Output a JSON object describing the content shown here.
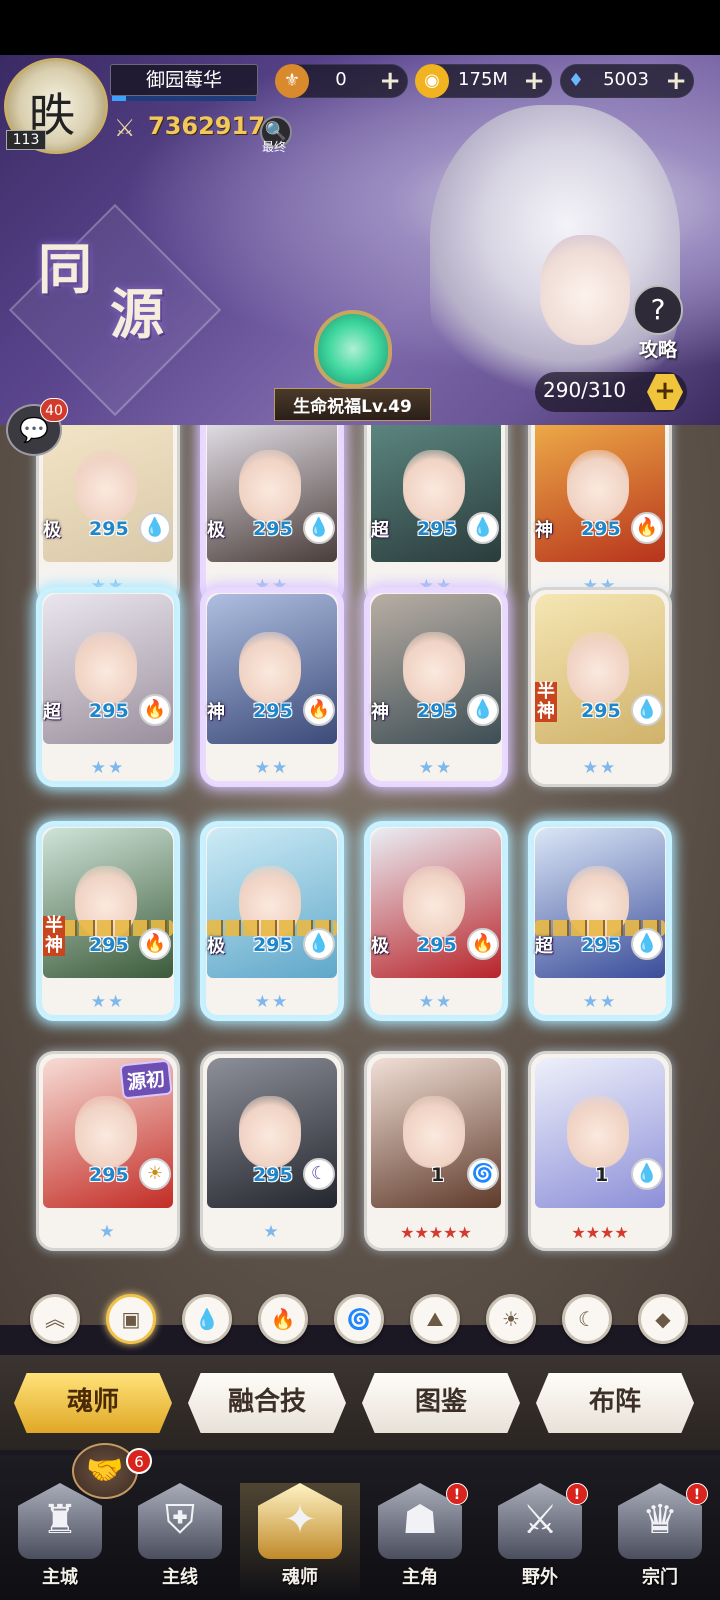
{
  "player": {
    "level": "113",
    "name": "御园莓华",
    "power": "7362917",
    "rank_label": "最终",
    "exp_progress": 0.1
  },
  "resources": [
    {
      "icon": "medal-icon",
      "value": "0"
    },
    {
      "icon": "gold-coin-icon",
      "value": "175M"
    },
    {
      "icon": "diamond-icon",
      "value": "5003"
    }
  ],
  "banner": {
    "title_char1": "同",
    "title_char2": "源",
    "strategy_label": "攻略",
    "blessing_label": "生命祝福Lv.49",
    "capacity": "290/310"
  },
  "chat": {
    "badge": "40"
  },
  "cards": [
    {
      "tier": "极",
      "level": "295",
      "element": "water",
      "stars": "★★",
      "art": [
        "#f4e6c8",
        "#d9c9a9"
      ],
      "glow": ""
    },
    {
      "tier": "极",
      "level": "295",
      "element": "water",
      "stars": "★★",
      "art": [
        "#e9e6ee",
        "#4a3d3a"
      ],
      "glow": "glowp"
    },
    {
      "tier": "超",
      "level": "295",
      "element": "water",
      "stars": "★★",
      "art": [
        "#5f8a84",
        "#2a3c3c"
      ],
      "glow": ""
    },
    {
      "tier": "神",
      "level": "295",
      "element": "fire",
      "stars": "★★",
      "art": [
        "#f0b14a",
        "#b7331c"
      ],
      "glow": ""
    },
    {
      "tier": "超",
      "level": "295",
      "element": "fire",
      "stars": "★★",
      "art": [
        "#eae6ee",
        "#9a8f9d"
      ],
      "glow": "glow"
    },
    {
      "tier": "神",
      "level": "295",
      "element": "fire",
      "stars": "★★",
      "art": [
        "#aebfe0",
        "#3b4a78"
      ],
      "glow": "glowp"
    },
    {
      "tier": "神",
      "level": "295",
      "element": "water",
      "stars": "★★",
      "art": [
        "#b9aea4",
        "#3d4e55"
      ],
      "glow": "glowp"
    },
    {
      "tier": "半神",
      "level": "295",
      "element": "water",
      "stars": "★★",
      "art": [
        "#f5e6b4",
        "#d0b26a"
      ],
      "glow": ""
    },
    {
      "tier": "半神",
      "level": "295",
      "element": "fire",
      "stars": "★★",
      "art": [
        "#cfe4d8",
        "#3b5a3a"
      ],
      "glow": "glow",
      "sealed": true
    },
    {
      "tier": "极",
      "level": "295",
      "element": "water",
      "stars": "★★",
      "art": [
        "#cdebf6",
        "#5fa7c9"
      ],
      "glow": "glow",
      "sealed": true
    },
    {
      "tier": "极",
      "level": "295",
      "element": "fire",
      "stars": "★★",
      "art": [
        "#e9eef4",
        "#b8232a"
      ],
      "glow": "glow"
    },
    {
      "tier": "超",
      "level": "295",
      "element": "water",
      "stars": "★★",
      "art": [
        "#dbe6f6",
        "#3a4d9a"
      ],
      "glow": "glow",
      "sealed": true
    },
    {
      "tier": "",
      "level": "295",
      "element": "light",
      "stars": "★",
      "art": [
        "#f6ddd6",
        "#c32c26"
      ],
      "glow": "",
      "badge": "源初"
    },
    {
      "tier": "",
      "level": "295",
      "element": "dark",
      "stars": "★",
      "art": [
        "#8d8f99",
        "#24262e"
      ],
      "glow": ""
    },
    {
      "tier": "",
      "level": "1",
      "element": "wind",
      "stars": "★★★★★",
      "art": [
        "#f1dfd6",
        "#5e3a2a"
      ],
      "glow": "",
      "red": true
    },
    {
      "tier": "",
      "level": "1",
      "element": "water",
      "stars": "★★★★",
      "art": [
        "#eef0fa",
        "#8c8fd8"
      ],
      "glow": "",
      "red": true
    }
  ],
  "elements": {
    "water": {
      "glyph": "💧",
      "color": "#1c8fd8"
    },
    "fire": {
      "glyph": "🔥",
      "color": "#c8322a"
    },
    "light": {
      "glyph": "☀",
      "color": "#c98d12"
    },
    "dark": {
      "glyph": "☾",
      "color": "#5e4fa8"
    },
    "wind": {
      "glyph": "🌀",
      "color": "#2f9a55"
    }
  },
  "filters": [
    {
      "name": "sort-filter-icon",
      "glyph": "︽"
    },
    {
      "name": "all-filter-icon",
      "glyph": "▣",
      "active": true
    },
    {
      "name": "water-filter-icon",
      "glyph": "💧"
    },
    {
      "name": "fire-filter-icon",
      "glyph": "🔥"
    },
    {
      "name": "wind-filter-icon",
      "glyph": "🌀"
    },
    {
      "name": "earth-filter-icon",
      "glyph": "⛰"
    },
    {
      "name": "light-filter-icon",
      "glyph": "☀"
    },
    {
      "name": "dark-filter-icon",
      "glyph": "☾"
    },
    {
      "name": "special-filter-icon",
      "glyph": "◆"
    }
  ],
  "tabs": [
    "魂师",
    "融合技",
    "图鉴",
    "布阵"
  ],
  "nav": [
    {
      "label": "主城",
      "glyph": "♜",
      "alert": false
    },
    {
      "label": "主线",
      "glyph": "⛨",
      "alert": false
    },
    {
      "label": "魂师",
      "glyph": "✦",
      "alert": false,
      "active": true
    },
    {
      "label": "主角",
      "glyph": "☗",
      "alert": true
    },
    {
      "label": "野外",
      "glyph": "⚔",
      "alert": true
    },
    {
      "label": "宗门",
      "glyph": "♛",
      "alert": true
    }
  ],
  "alert_mark": "!",
  "friend": {
    "badge": "6"
  }
}
